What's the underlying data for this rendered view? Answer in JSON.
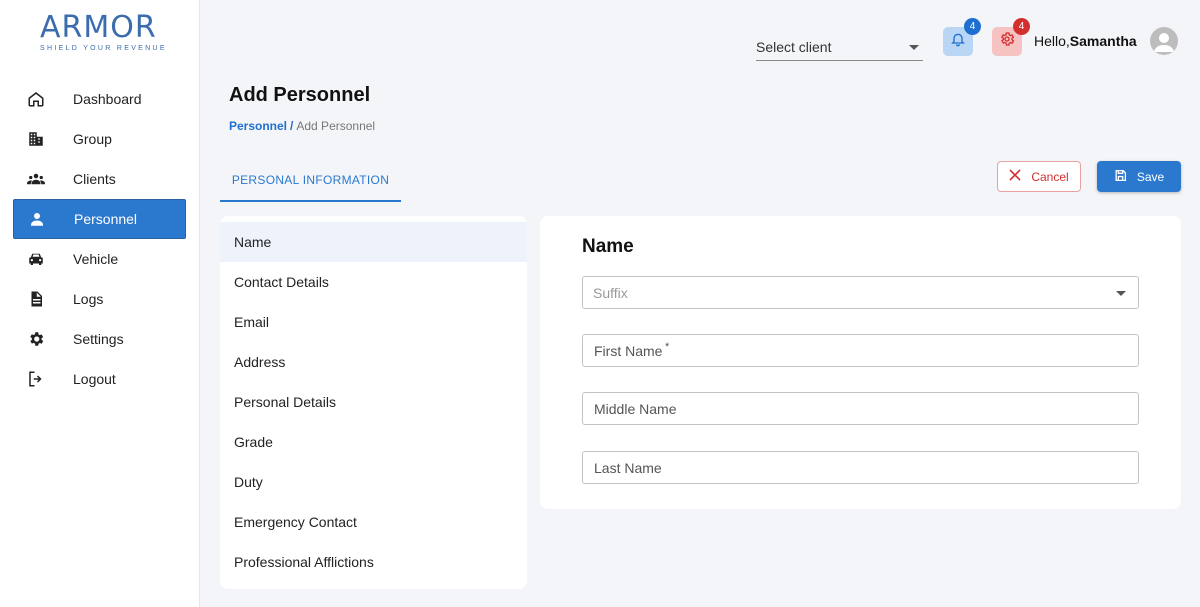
{
  "logo": {
    "text": "ARMOR",
    "tagline": "SHIELD YOUR REVENUE"
  },
  "sidebar": {
    "items": [
      {
        "label": "Dashboard",
        "icon": "home-icon",
        "active": false
      },
      {
        "label": "Group",
        "icon": "building-icon",
        "active": false
      },
      {
        "label": "Clients",
        "icon": "people-icon",
        "active": false
      },
      {
        "label": "Personnel",
        "icon": "person-icon",
        "active": true
      },
      {
        "label": "Vehicle",
        "icon": "car-icon",
        "active": false
      },
      {
        "label": "Logs",
        "icon": "document-icon",
        "active": false
      },
      {
        "label": "Settings",
        "icon": "gear-icon",
        "active": false
      },
      {
        "label": "Logout",
        "icon": "logout-icon",
        "active": false
      }
    ]
  },
  "header": {
    "client_select": {
      "value": "Select client"
    },
    "notifications": {
      "count": "4",
      "icon": "bell-icon"
    },
    "settings": {
      "count": "4",
      "icon": "gear-icon"
    },
    "greeting_prefix": "Hello,",
    "user_name": "Samantha"
  },
  "page": {
    "title": "Add Personnel",
    "breadcrumb": {
      "link": "Personnel",
      "separator": "/",
      "current": "Add Personnel"
    },
    "tab": "PERSONAL INFORMATION",
    "cancel_label": "Cancel",
    "save_label": "Save"
  },
  "sections": [
    "Name",
    "Contact Details",
    "Email",
    "Address",
    "Personal Details",
    "Grade",
    "Duty",
    "Emergency Contact",
    "Professional Afflictions"
  ],
  "form": {
    "title": "Name",
    "suffix_placeholder": "Suffix",
    "first_name_placeholder": "First Name",
    "required_mark": "*",
    "middle_name_placeholder": "Middle Name",
    "last_name_placeholder": "Last Name"
  },
  "colors": {
    "primary": "#2b79cf",
    "danger": "#d32f2f",
    "notif_bg": "#b9d7f5",
    "settings_bg": "#f7c2c2"
  }
}
